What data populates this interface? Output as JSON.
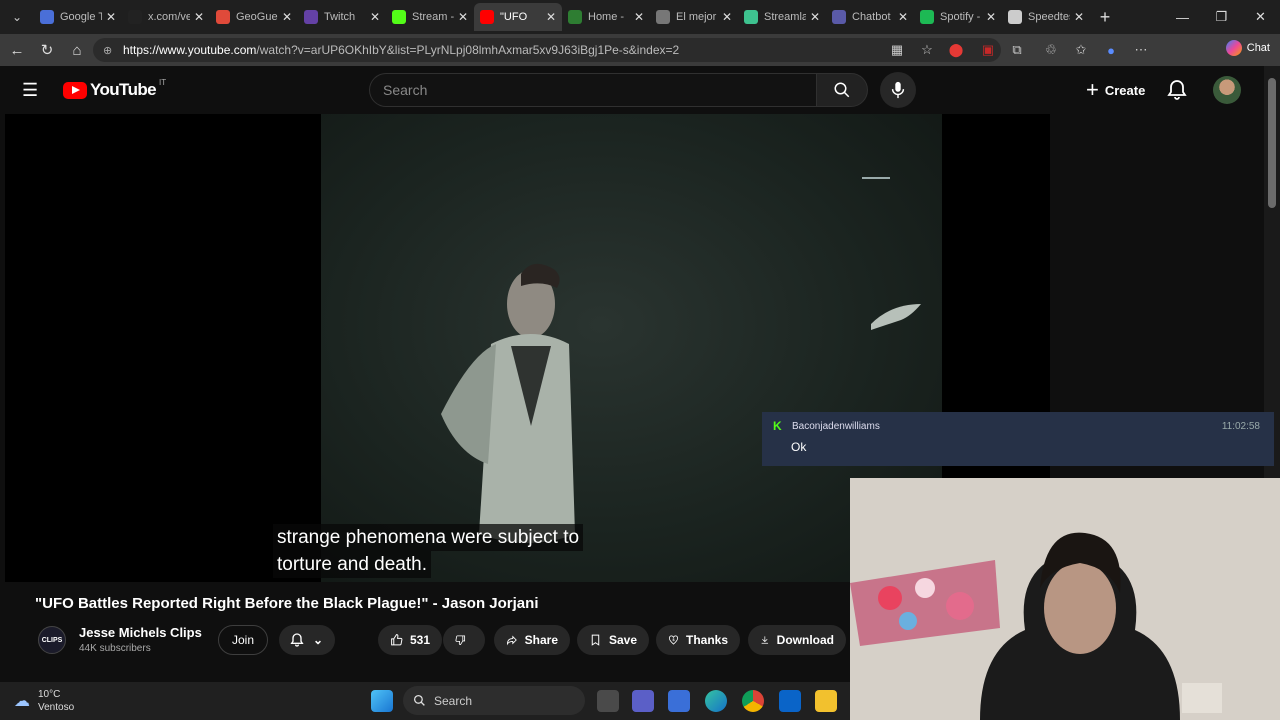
{
  "browser": {
    "tabs": [
      {
        "label": "Google T",
        "color": "#4a6fd8"
      },
      {
        "label": "x.com/ve",
        "color": "#222222"
      },
      {
        "label": "GeoGues",
        "color": "#e04a3a"
      },
      {
        "label": "Twitch",
        "color": "#6441a5"
      },
      {
        "label": "Stream -",
        "color": "#53fc18"
      },
      {
        "label": "\"UFO",
        "color": "#ff0000",
        "active": true
      },
      {
        "label": "Home -",
        "color": "#2e7d32"
      },
      {
        "label": "El mejor",
        "color": "#777777"
      },
      {
        "label": "Streamla",
        "color": "#3ec28f"
      },
      {
        "label": "Chatbot",
        "color": "#5a5aa8"
      },
      {
        "label": "Spotify -",
        "color": "#1db954"
      },
      {
        "label": "Speedtes",
        "color": "#cccccc"
      }
    ],
    "url_host": "https://www.youtube.com",
    "url_path": "/watch?v=arUP6OKhIbY&list=PLyrNLpj08lmhAxmar5xv9J63iBgj1Pe-s&index=2",
    "chat_label": "Chat"
  },
  "youtube": {
    "logo_text": "YouTube",
    "country_code": "IT",
    "search_placeholder": "Search",
    "create_label": "Create"
  },
  "player": {
    "subtitle_line1": "strange phenomena were subject to",
    "subtitle_line2": "torture and death."
  },
  "notification": {
    "username": "Baconjadenwilliams",
    "time": "11:02:58",
    "message": "Ok"
  },
  "video": {
    "title": "\"UFO Battles Reported Right Before the Black Plague!\" - Jason Jorjani",
    "channel_name": "Jesse Michels Clips",
    "channel_avatar_text": "CLIPS",
    "subscribers": "44K subscribers",
    "join_label": "Join",
    "likes": "531",
    "share_label": "Share",
    "save_label": "Save",
    "thanks_label": "Thanks",
    "download_label": "Download"
  },
  "taskbar": {
    "temperature": "10°C",
    "weather": "Ventoso",
    "search_label": "Search"
  }
}
